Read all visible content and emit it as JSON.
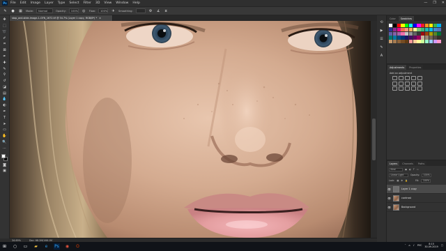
{
  "menubar": {
    "logo": "Ps",
    "items": [
      "File",
      "Edit",
      "Image",
      "Layer",
      "Type",
      "Select",
      "Filter",
      "3D",
      "View",
      "Window",
      "Help"
    ],
    "window_controls": [
      "—",
      "❐",
      "✕"
    ]
  },
  "options": {
    "mode_label": "Mode:",
    "mode_value": "Normal",
    "opacity_label": "Opacity:",
    "opacity_value": "100%",
    "flow_label": "Flow:",
    "flow_value": "100%",
    "smoothing_label": "Smoothing:",
    "smoothing_value": ""
  },
  "document": {
    "tab_title": "stop_and-slide-image-1-GFN_1672.tif @ 34.7% (Layer 1 copy, RGB/8*) *",
    "close": "×"
  },
  "status": {
    "zoom": "34.69%",
    "doc": "Doc: 68.2M/168.1M"
  },
  "panels": {
    "swatches_tabs": [
      "Color",
      "Swatches"
    ],
    "swatch_colors": [
      "#ffffff",
      "#000000",
      "#ff0000",
      "#ffff00",
      "#00ff00",
      "#00ffff",
      "#0000ff",
      "#ff00ff",
      "#ed1c24",
      "#f7941d",
      "#fff200",
      "#39b54a",
      "#00aeef",
      "#2e3192",
      "#92278f",
      "#ec008c",
      "#f26c4f",
      "#f69679",
      "#fbaf5d",
      "#fff799",
      "#7cc576",
      "#3cb878",
      "#1abbb4",
      "#00bff3",
      "#448ccb",
      "#5674b9",
      "#605ca8",
      "#8560a8",
      "#a763a8",
      "#f06eaa",
      "#c6c6c6",
      "#959595",
      "#636363",
      "#363636",
      "#9e0b0f",
      "#a0410d",
      "#aba000",
      "#598527",
      "#007236",
      "#00746b",
      "#0076a3",
      "#004a80",
      "#003471",
      "#1b1464",
      "#440e62",
      "#630460",
      "#9e005d",
      "#c7b299",
      "#998675",
      "#736357",
      "#534741",
      "#37302a",
      "#c69c6d",
      "#a67c52",
      "#8c6239",
      "#754c24",
      "#603913",
      "#ff9999",
      "#ffcc99",
      "#ffff99",
      "#ccff99",
      "#99ffcc",
      "#99ccff",
      "#cc99ff",
      "#ff99cc"
    ],
    "adjust_tabs": [
      "Adjustments",
      "Properties"
    ],
    "adjust_title": "Add an adjustment",
    "layers_tabs": [
      "Layers",
      "Channels",
      "Paths"
    ],
    "kind": "Kind",
    "blend_mode": "Linear Light",
    "opacity_label": "Opacity:",
    "opacity_value": "100%",
    "lock_label": "Lock:",
    "fill_label": "Fill:",
    "fill_value": "100%",
    "layers": [
      {
        "name": "Layer 1 copy",
        "thumb": "grey",
        "selected": true
      },
      {
        "name": "contrast",
        "thumb": "face",
        "selected": false
      },
      {
        "name": "Background",
        "thumb": "face",
        "selected": false
      }
    ]
  },
  "taskbar": {
    "lang": "РУС",
    "time": "8:15",
    "date": "30.09.2019"
  }
}
